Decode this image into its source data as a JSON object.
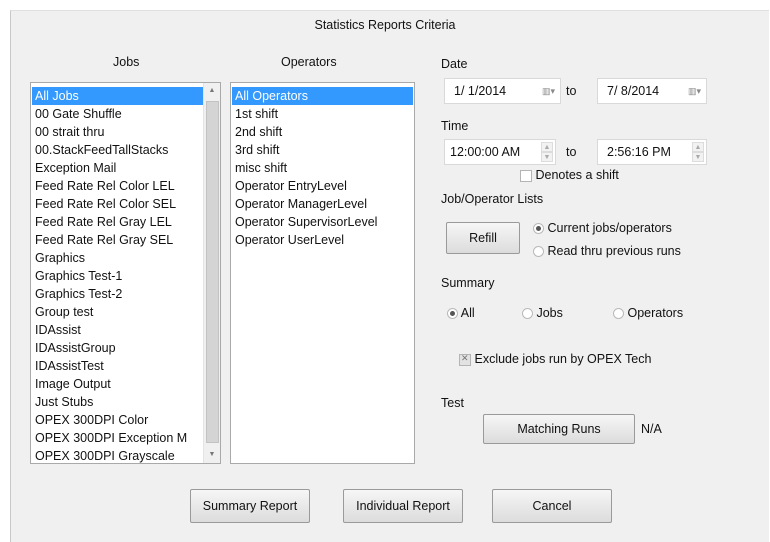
{
  "dialog": {
    "title": "Statistics Reports Criteria"
  },
  "jobs": {
    "header": "Jobs",
    "items": [
      "All Jobs",
      "00 Gate Shuffle",
      "00 strait thru",
      "00.StackFeedTallStacks",
      "Exception Mail",
      "Feed Rate Rel Color LEL",
      "Feed Rate Rel Color SEL",
      "Feed Rate Rel Gray LEL",
      "Feed Rate Rel Gray SEL",
      "Graphics",
      "Graphics Test-1",
      "Graphics Test-2",
      "Group test",
      "IDAssist",
      "IDAssistGroup",
      "IDAssistTest",
      "Image Output",
      "Just Stubs",
      "OPEX 300DPI Color",
      "OPEX 300DPI Exception M",
      "OPEX 300DPI Grayscale"
    ]
  },
  "operators": {
    "header": "Operators",
    "items": [
      "All Operators",
      " 1st shift",
      " 2nd shift",
      " 3rd shift",
      " misc shift",
      "Operator EntryLevel",
      "Operator ManagerLevel",
      "Operator SupervisorLevel",
      "Operator UserLevel"
    ]
  },
  "date": {
    "label": "Date",
    "from": "1/  1/2014",
    "to_label": "to",
    "to": "7/  8/2014"
  },
  "time": {
    "label": "Time",
    "from": "12:00:00 AM",
    "to_label": "to",
    "to": "2:56:16 PM",
    "denotes_shift_label": "Denotes a shift",
    "denotes_shift_checked": false
  },
  "lists": {
    "label": "Job/Operator Lists",
    "refill_label": "Refill",
    "current_label": "Current jobs/operators",
    "read_label": "Read thru previous runs",
    "selected": "current"
  },
  "summary": {
    "label": "Summary",
    "all_label": "All",
    "jobs_label": "Jobs",
    "operators_label": "Operators",
    "selected": "all",
    "exclude_label": "Exclude jobs run by OPEX Tech",
    "exclude_checked": true
  },
  "test": {
    "label": "Test",
    "matching_runs_label": "Matching Runs",
    "result": "N/A"
  },
  "footer": {
    "summary_report_label": "Summary Report",
    "individual_report_label": "Individual Report",
    "cancel_label": "Cancel"
  },
  "icons": {
    "dropdown": "calendar-dropdown-icon",
    "spin": "spin-arrows-icon"
  },
  "colors": {
    "selection": "#3399ff",
    "dialog_bg": "#f0f0f0"
  }
}
